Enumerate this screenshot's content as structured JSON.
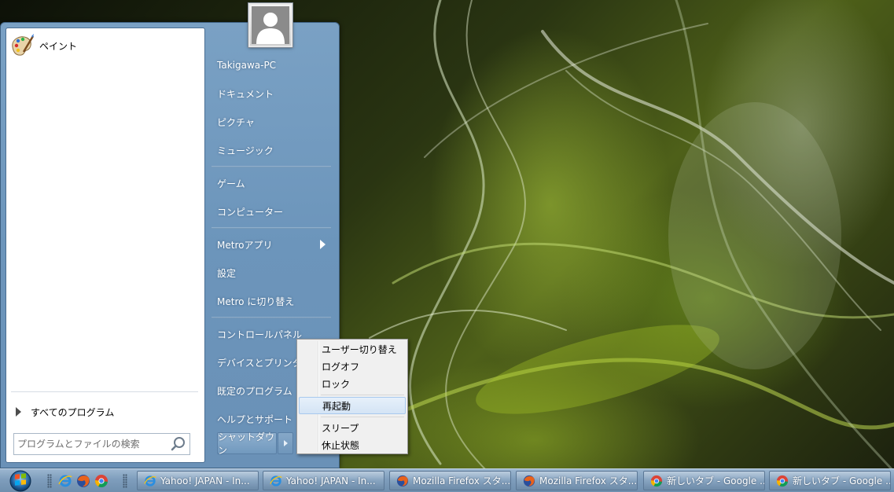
{
  "start_menu": {
    "pinned": [
      {
        "label": "ペイント",
        "icon": "paint-palette-icon"
      }
    ],
    "all_programs_label": "すべてのプログラム",
    "search": {
      "placeholder": "プログラムとファイルの検索",
      "value": "",
      "icon": "search-icon"
    },
    "user_picture_icon": "user-avatar-icon",
    "right_links": [
      {
        "label": "Takigawa-PC"
      },
      {
        "label": "ドキュメント"
      },
      {
        "label": "ピクチャ"
      },
      {
        "label": "ミュージック"
      },
      {
        "label": "ゲーム"
      },
      {
        "label": "コンピューター"
      },
      {
        "label": "Metroアプリ"
      },
      {
        "label": "設定"
      },
      {
        "label": "Metro に切り替え"
      },
      {
        "label": "コントロールパネル"
      },
      {
        "label": "デバイスとプリンター"
      },
      {
        "label": "既定のプログラム"
      },
      {
        "label": "ヘルプとサポート"
      }
    ],
    "shutdown_label": "シャットダウン"
  },
  "shutdown_menu": {
    "items": [
      {
        "label": "ユーザー切り替え"
      },
      {
        "label": "ログオフ"
      },
      {
        "label": "ロック"
      },
      {
        "label": "再起動"
      },
      {
        "label": "スリープ"
      },
      {
        "label": "休止状態"
      }
    ],
    "highlighted": "再起動"
  },
  "taskbar": {
    "quick_launch": [
      "ie-icon",
      "firefox-icon",
      "chrome-icon"
    ],
    "tasks": [
      {
        "label": "Yahoo! JAPAN - In...",
        "icon": "ie-icon"
      },
      {
        "label": "Yahoo! JAPAN - In...",
        "icon": "ie-icon"
      },
      {
        "label": "Mozilla Firefox スタ...",
        "icon": "firefox-icon"
      },
      {
        "label": "Mozilla Firefox スタ...",
        "icon": "firefox-icon"
      },
      {
        "label": "新しいタブ - Google ...",
        "icon": "chrome-icon"
      },
      {
        "label": "新しいタブ - Google ...",
        "icon": "chrome-icon"
      }
    ]
  },
  "colors": {
    "start_menu_blue": "#6c95bb",
    "taskbar_blue": "#7e9dbc",
    "menu_highlight": "#d4e4f5"
  }
}
